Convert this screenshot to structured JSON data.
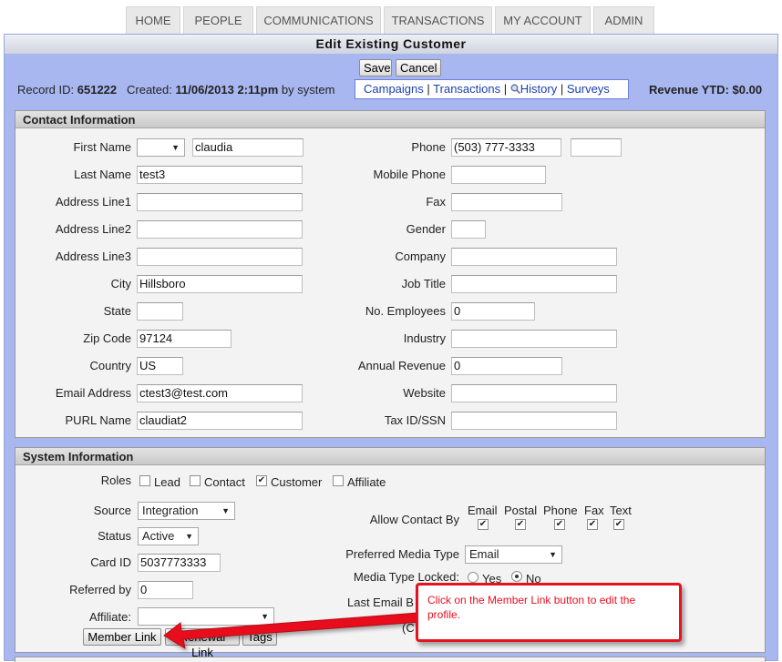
{
  "nav": {
    "tabs": [
      "HOME",
      "PEOPLE",
      "COMMUNICATIONS",
      "TRANSACTIONS",
      "MY ACCOUNT",
      "ADMIN"
    ]
  },
  "title": "Edit Existing Customer",
  "actions": {
    "save": "Save",
    "cancel": "Cancel"
  },
  "record": {
    "id_label": "Record ID:",
    "id": "651222",
    "created_label": "Created:",
    "created": "11/06/2013 2:11pm",
    "by": "by system",
    "revenue_label": "Revenue YTD:",
    "revenue": "$0.00"
  },
  "links": {
    "campaigns": "Campaigns",
    "transactions": "Transactions",
    "history": "History",
    "surveys": "Surveys",
    "sep": "|"
  },
  "contact": {
    "heading": "Contact Information",
    "left": [
      {
        "label": "First Name",
        "value": "claudia"
      },
      {
        "label": "Last Name",
        "value": "test3"
      },
      {
        "label": "Address Line1",
        "value": ""
      },
      {
        "label": "Address Line2",
        "value": ""
      },
      {
        "label": "Address Line3",
        "value": ""
      },
      {
        "label": "City",
        "value": "Hillsboro"
      },
      {
        "label": "State",
        "value": ""
      },
      {
        "label": "Zip Code",
        "value": "97124"
      },
      {
        "label": "Country",
        "value": "US"
      },
      {
        "label": "Email Address",
        "value": "ctest3@test.com"
      },
      {
        "label": "PURL Name",
        "value": "claudiat2"
      }
    ],
    "right": [
      {
        "label": "Phone",
        "value": "(503) 777-3333",
        "ext": ""
      },
      {
        "label": "Mobile Phone",
        "value": ""
      },
      {
        "label": "Fax",
        "value": ""
      },
      {
        "label": "Gender",
        "value": ""
      },
      {
        "label": "Company",
        "value": ""
      },
      {
        "label": "Job Title",
        "value": ""
      },
      {
        "label": "No. Employees",
        "value": "0"
      },
      {
        "label": "Industry",
        "value": ""
      },
      {
        "label": "Annual Revenue",
        "value": "0"
      },
      {
        "label": "Website",
        "value": ""
      },
      {
        "label": "Tax ID/SSN",
        "value": ""
      }
    ]
  },
  "system": {
    "heading": "System Information",
    "roles_label": "Roles",
    "roles": [
      {
        "label": "Lead",
        "checked": false
      },
      {
        "label": "Contact",
        "checked": false
      },
      {
        "label": "Customer",
        "checked": true
      },
      {
        "label": "Affiliate",
        "checked": false
      }
    ],
    "source_label": "Source",
    "source": "Integration",
    "status_label": "Status",
    "status": "Active",
    "card_label": "Card ID",
    "card": "5037773333",
    "referred_label": "Referred by",
    "referred": "0",
    "affiliate_label": "Affiliate:",
    "affiliate": "",
    "allow_label": "Allow Contact By",
    "allow": [
      {
        "label": "Email",
        "checked": true
      },
      {
        "label": "Postal",
        "checked": true
      },
      {
        "label": "Phone",
        "checked": true
      },
      {
        "label": "Fax",
        "checked": true
      },
      {
        "label": "Text",
        "checked": true
      }
    ],
    "media_label": "Preferred Media Type",
    "media": "Email",
    "locked_label": "Media Type Locked:",
    "yes": "Yes",
    "no": "No",
    "locked": "No",
    "last_email_label": "Last Email B",
    "last_email_sub": "(C"
  },
  "buttons": {
    "member_link": "Member Link",
    "renewal_link": "Renewal Link",
    "tags": "Tags"
  },
  "callout": {
    "text": "Click on the Member Link button to edit the profile.",
    "color": "#e8111f"
  }
}
